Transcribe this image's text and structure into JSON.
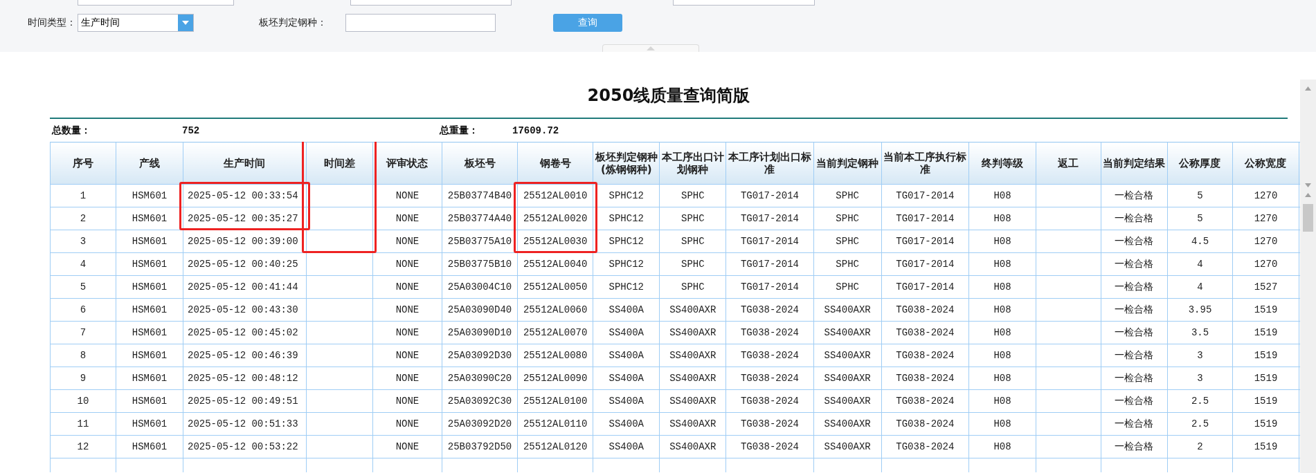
{
  "filters": {
    "time_type": {
      "label": "时间类型：",
      "value": "生产时间"
    },
    "slab_grade": {
      "label": "板坯判定钢种："
    },
    "query_button": "查询"
  },
  "report": {
    "title": "2050线质量查询简版",
    "summary": [
      {
        "label": "总数量：",
        "value": "752"
      },
      {
        "label": "总重量：",
        "value": "17609.72"
      }
    ]
  },
  "table": {
    "columns": [
      "序号",
      "产线",
      "生产时间",
      "时间差",
      "评审状态",
      "板坯号",
      "钢卷号",
      "板坯判定钢种(炼钢钢种)",
      "本工序出口计划钢种",
      "本工序计划出口标准",
      "当前判定钢种",
      "当前本工序执行标准",
      "终判等级",
      "返工",
      "当前判定结果",
      "公称厚度",
      "公称宽度"
    ],
    "header_boxed": {
      "production_time": false,
      "time_difference": true,
      "coil_number": false
    },
    "rows": [
      {
        "cells": [
          "1",
          "HSM601",
          "2025-05-12 00:33:54",
          "",
          "NONE",
          "25B03774B40",
          "25512AL0010",
          "SPHC12",
          "SPHC",
          "TG017-2014",
          "SPHC",
          "TG017-2014",
          "H08",
          "",
          "一检合格",
          "5",
          "1270"
        ],
        "boxed": {
          "production_time": true,
          "time_difference": true,
          "coil_number": true
        }
      },
      {
        "cells": [
          "2",
          "HSM601",
          "2025-05-12 00:35:27",
          "",
          "NONE",
          "25B03774A40",
          "25512AL0020",
          "SPHC12",
          "SPHC",
          "TG017-2014",
          "SPHC",
          "TG017-2014",
          "H08",
          "",
          "一检合格",
          "5",
          "1270"
        ],
        "boxed": {
          "production_time": true,
          "time_difference": true,
          "coil_number": true
        }
      },
      {
        "cells": [
          "3",
          "HSM601",
          "2025-05-12 00:39:00",
          "",
          "NONE",
          "25B03775A10",
          "25512AL0030",
          "SPHC12",
          "SPHC",
          "TG017-2014",
          "SPHC",
          "TG017-2014",
          "H08",
          "",
          "一检合格",
          "4.5",
          "1270"
        ],
        "boxed": {
          "production_time": false,
          "time_difference": true,
          "coil_number": true
        }
      },
      {
        "cells": [
          "4",
          "HSM601",
          "2025-05-12 00:40:25",
          "",
          "NONE",
          "25B03775B10",
          "25512AL0040",
          "SPHC12",
          "SPHC",
          "TG017-2014",
          "SPHC",
          "TG017-2014",
          "H08",
          "",
          "一检合格",
          "4",
          "1270"
        ],
        "boxed": {
          "production_time": false,
          "time_difference": false,
          "coil_number": false
        }
      },
      {
        "cells": [
          "5",
          "HSM601",
          "2025-05-12 00:41:44",
          "",
          "NONE",
          "25A03004C10",
          "25512AL0050",
          "SPHC12",
          "SPHC",
          "TG017-2014",
          "SPHC",
          "TG017-2014",
          "H08",
          "",
          "一检合格",
          "4",
          "1527"
        ],
        "boxed": {
          "production_time": false,
          "time_difference": false,
          "coil_number": false
        }
      },
      {
        "cells": [
          "6",
          "HSM601",
          "2025-05-12 00:43:30",
          "",
          "NONE",
          "25A03090D40",
          "25512AL0060",
          "SS400A",
          "SS400AXR",
          "TG038-2024",
          "SS400AXR",
          "TG038-2024",
          "H08",
          "",
          "一检合格",
          "3.95",
          "1519"
        ],
        "boxed": {
          "production_time": false,
          "time_difference": false,
          "coil_number": false
        }
      },
      {
        "cells": [
          "7",
          "HSM601",
          "2025-05-12 00:45:02",
          "",
          "NONE",
          "25A03090D10",
          "25512AL0070",
          "SS400A",
          "SS400AXR",
          "TG038-2024",
          "SS400AXR",
          "TG038-2024",
          "H08",
          "",
          "一检合格",
          "3.5",
          "1519"
        ],
        "boxed": {
          "production_time": false,
          "time_difference": false,
          "coil_number": false
        }
      },
      {
        "cells": [
          "8",
          "HSM601",
          "2025-05-12 00:46:39",
          "",
          "NONE",
          "25A03092D30",
          "25512AL0080",
          "SS400A",
          "SS400AXR",
          "TG038-2024",
          "SS400AXR",
          "TG038-2024",
          "H08",
          "",
          "一检合格",
          "3",
          "1519"
        ],
        "boxed": {
          "production_time": false,
          "time_difference": false,
          "coil_number": false
        }
      },
      {
        "cells": [
          "9",
          "HSM601",
          "2025-05-12 00:48:12",
          "",
          "NONE",
          "25A03090C20",
          "25512AL0090",
          "SS400A",
          "SS400AXR",
          "TG038-2024",
          "SS400AXR",
          "TG038-2024",
          "H08",
          "",
          "一检合格",
          "3",
          "1519"
        ],
        "boxed": {
          "production_time": false,
          "time_difference": false,
          "coil_number": false
        }
      },
      {
        "cells": [
          "10",
          "HSM601",
          "2025-05-12 00:49:51",
          "",
          "NONE",
          "25A03092C30",
          "25512AL0100",
          "SS400A",
          "SS400AXR",
          "TG038-2024",
          "SS400AXR",
          "TG038-2024",
          "H08",
          "",
          "一检合格",
          "2.5",
          "1519"
        ],
        "boxed": {
          "production_time": false,
          "time_difference": false,
          "coil_number": false
        }
      },
      {
        "cells": [
          "11",
          "HSM601",
          "2025-05-12 00:51:33",
          "",
          "NONE",
          "25A03092D20",
          "25512AL0110",
          "SS400A",
          "SS400AXR",
          "TG038-2024",
          "SS400AXR",
          "TG038-2024",
          "H08",
          "",
          "一检合格",
          "2.5",
          "1519"
        ],
        "boxed": {
          "production_time": false,
          "time_difference": false,
          "coil_number": false
        }
      },
      {
        "cells": [
          "12",
          "HSM601",
          "2025-05-12 00:53:22",
          "",
          "NONE",
          "25B03792D50",
          "25512AL0120",
          "SS400A",
          "SS400AXR",
          "TG038-2024",
          "SS400AXR",
          "TG038-2024",
          "H08",
          "",
          "一检合格",
          "2",
          "1519"
        ],
        "boxed": {
          "production_time": false,
          "time_difference": false,
          "coil_number": false
        }
      }
    ]
  }
}
